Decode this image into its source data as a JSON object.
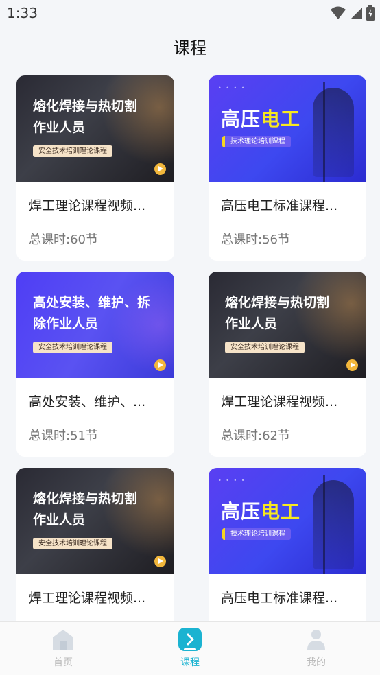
{
  "status_bar": {
    "time": "1:33"
  },
  "header": {
    "title": "课程"
  },
  "courses": [
    {
      "name": "焊工理论课程视频...",
      "hours": "总课时:60节",
      "thumb_title_1": "熔化焊接与热切割",
      "thumb_title_2": "作业人员",
      "thumb_tag": "安全技术培训理论课程"
    },
    {
      "name": "高压电工标准课程...",
      "hours": "总课时:56节",
      "thumb_big_1": "高压",
      "thumb_big_2": "电工",
      "thumb_tag": "技术理论培训课程"
    },
    {
      "name": "高处安装、维护、...",
      "hours": "总课时:51节",
      "thumb_title_1": "高处安装、维护、拆",
      "thumb_title_2": "除作业人员",
      "thumb_tag": "安全技术培训理论课程"
    },
    {
      "name": "焊工理论课程视频...",
      "hours": "总课时:62节",
      "thumb_title_1": "熔化焊接与热切割",
      "thumb_title_2": "作业人员",
      "thumb_tag": "安全技术培训理论课程"
    },
    {
      "name": "焊工理论课程视频...",
      "hours": "",
      "thumb_title_1": "熔化焊接与热切割",
      "thumb_title_2": "作业人员",
      "thumb_tag": "安全技术培训理论课程"
    },
    {
      "name": "高压电工标准课程...",
      "hours": "",
      "thumb_big_1": "高压",
      "thumb_big_2": "电工",
      "thumb_tag": "技术理论培训课程"
    }
  ],
  "tabbar": {
    "items": [
      {
        "label": "首页",
        "icon": "home-icon"
      },
      {
        "label": "课程",
        "icon": "course-icon",
        "active": true
      },
      {
        "label": "我的",
        "icon": "profile-icon"
      }
    ]
  },
  "colors": {
    "accent": "#1bb3d1",
    "inactive": "#bbbbbb"
  }
}
